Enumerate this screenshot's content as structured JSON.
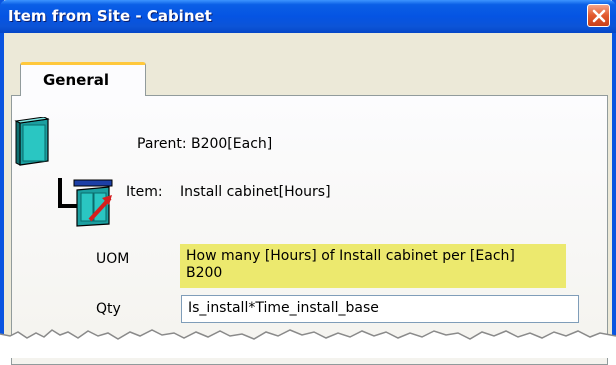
{
  "window": {
    "title": "Item from Site - Cabinet"
  },
  "tabs": [
    {
      "label": "General",
      "active": true
    }
  ],
  "general": {
    "parent_text": "Parent: B200[Each]",
    "item_label": "Item:",
    "item_value": "Install cabinet[Hours]",
    "uom_label": "UOM",
    "uom_text_line1": "How many [Hours] of Install cabinet per [Each]",
    "uom_text_line2": "B200",
    "qty_label": "Qty",
    "qty_value": "Is_install*Time_install_base"
  },
  "icons": {
    "parent": "cabinet-icon",
    "item": "install-cabinet-icon",
    "close": "close-icon"
  },
  "colors": {
    "titlebar": "#0554e3",
    "close_button": "#e2592d",
    "tab_highlight": "#ffc83c",
    "uom_highlight": "#ece96e",
    "cabinet": "#2ac6c2"
  }
}
